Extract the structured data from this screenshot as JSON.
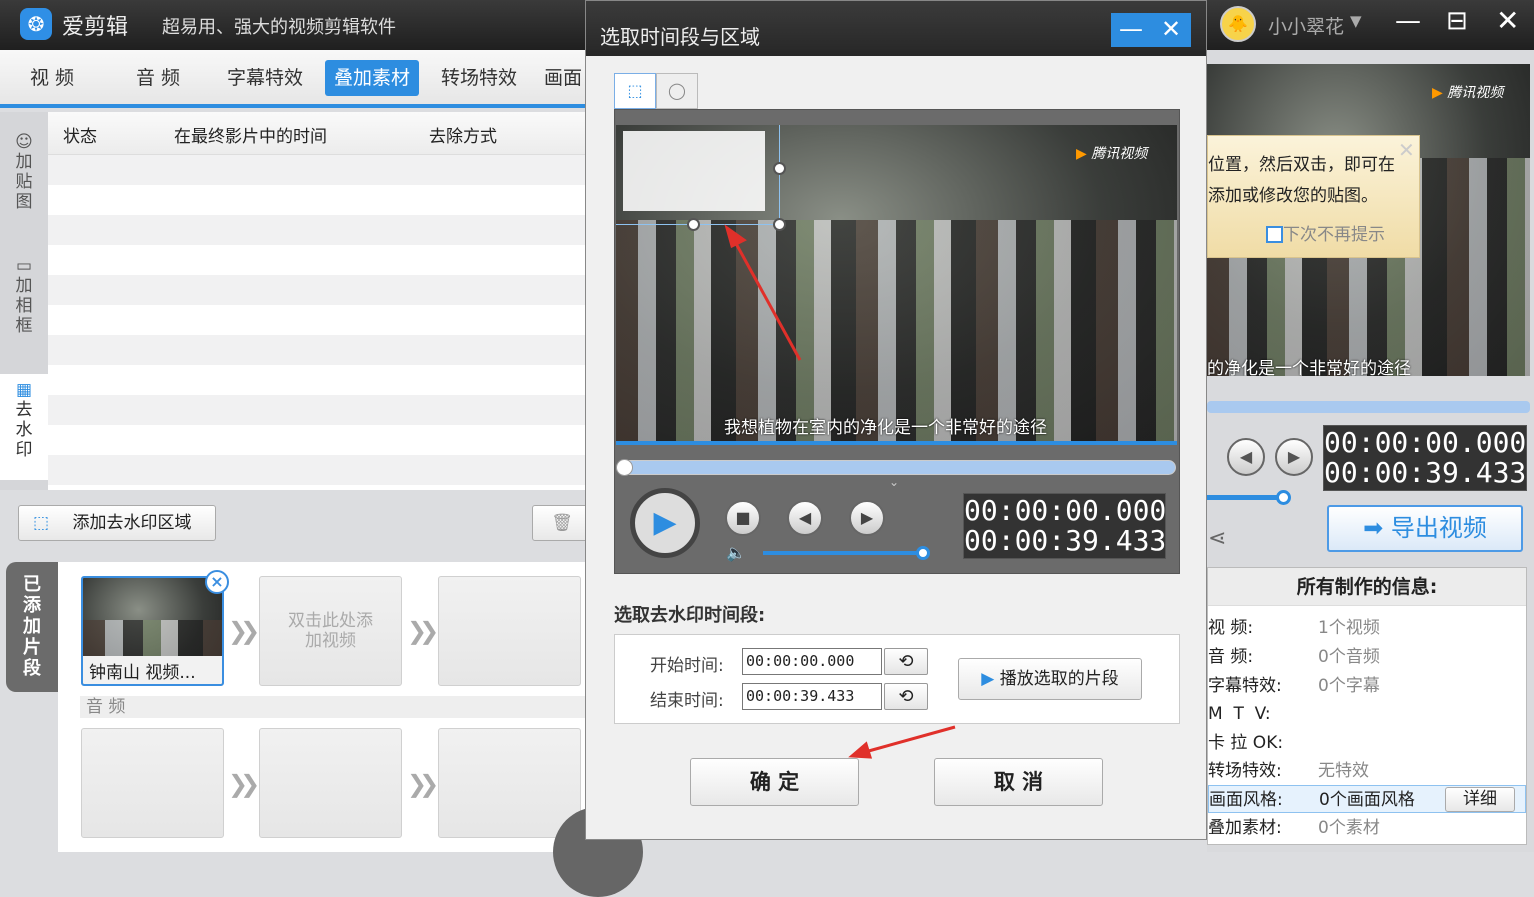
{
  "app": {
    "name": "爱剪辑",
    "slogan": "超易用、强大的视频剪辑软件",
    "user": "小小翠花"
  },
  "tabs": [
    "视 频",
    "音 频",
    "字幕特效",
    "叠加素材",
    "转场特效",
    "画面"
  ],
  "active_tab": "叠加素材",
  "sidebar": [
    "加贴图",
    "加相框",
    "去水印"
  ],
  "table": {
    "headers": [
      "状态",
      "在最终影片中的时间",
      "去除方式"
    ]
  },
  "toolbar": {
    "add_watermark_area": "添加去水印区域"
  },
  "clips": {
    "tab_label": "已添加片段",
    "clip_name": "钟南山 视频...",
    "add_hint": "双击此处添加视频",
    "audio_label": "音 频"
  },
  "dialog": {
    "title": "选取时间段与区域",
    "video_subtitle": "我想植物在室内的净化是一个非常好的途径",
    "watermark_brand": "腾讯视频",
    "current_time": "00:00:00.000",
    "total_time": "00:00:39.433",
    "section_label": "选取去水印时间段:",
    "start_label": "开始时间:",
    "start_value": "00:00:00.000",
    "end_label": "结束时间:",
    "end_value": "00:00:39.433",
    "play_selected": "播放选取的片段",
    "ok": "确 定",
    "cancel": "取 消",
    "volume": 0.9,
    "progress": 0
  },
  "preview": {
    "tooltip_line1": "位置，然后双击，即可在",
    "tooltip_line2": "添加或修改您的贴图。",
    "tooltip_checkbox": "下次不再提示",
    "subtitle": "的净化是一个非常好的途径",
    "current_time": "00:00:00.000",
    "total_time": "00:00:39.433",
    "export": "导出视频"
  },
  "info": {
    "title": "所有制作的信息:",
    "rows": [
      {
        "k": "视    频:",
        "v": "1个视频"
      },
      {
        "k": "音    频:",
        "v": "0个音频"
      },
      {
        "k": "字幕特效:",
        "v": "0个字幕"
      },
      {
        "k": "M  T  V:",
        "v": ""
      },
      {
        "k": "卡 拉 OK:",
        "v": ""
      },
      {
        "k": "转场特效:",
        "v": "无特效"
      },
      {
        "k": "画面风格:",
        "v": "0个画面风格"
      },
      {
        "k": "叠加素材:",
        "v": "0个素材"
      }
    ],
    "detail": "详细"
  }
}
